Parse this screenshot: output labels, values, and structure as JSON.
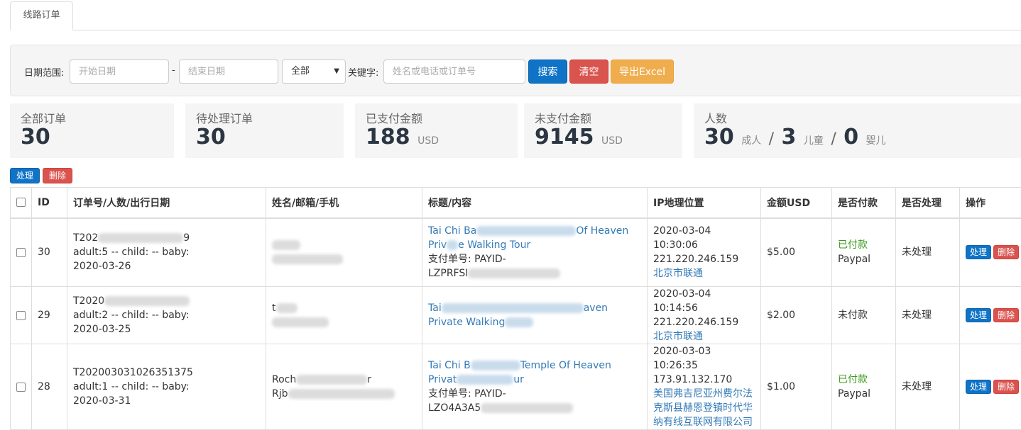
{
  "tabs": [
    {
      "label": "线路订单",
      "active": true
    }
  ],
  "filter": {
    "date_range_label": "日期范围:",
    "start_placeholder": "开始日期",
    "dash": "-",
    "end_placeholder": "结束日期",
    "status_select": "全部",
    "keyword_label": "关键字:",
    "keyword_placeholder": "姓名或电话或订单号",
    "search_button": "搜索",
    "clear_button": "清空",
    "export_button": "导出Excel"
  },
  "stats": {
    "all_orders": {
      "title": "全部订单",
      "value": "30"
    },
    "pending_orders": {
      "title": "待处理订单",
      "value": "30"
    },
    "paid_amount": {
      "title": "已支付金额",
      "value": "188",
      "unit": "USD"
    },
    "unpaid_amount": {
      "title": "未支付金额",
      "value": "9145",
      "unit": "USD"
    },
    "people": {
      "title": "人数",
      "adults": "30",
      "adults_label": "成人",
      "children": "3",
      "children_label": "儿童",
      "babies": "0",
      "babies_label": "婴儿",
      "sep": "/"
    }
  },
  "bulk": {
    "process_label": "处理",
    "delete_label": "删除"
  },
  "table": {
    "headers": {
      "id": "ID",
      "order": "订单号/人数/出行日期",
      "contact": "姓名/邮箱/手机",
      "title": "标题/内容",
      "ip": "IP地理位置",
      "amount": "金额USD",
      "paid": "是否付款",
      "processed": "是否处理",
      "ops": "操作"
    },
    "rows": [
      {
        "id": "30",
        "order_no_start": "T202",
        "order_no_end": "9",
        "people": "adult:5 -- child: -- baby:",
        "travel_date": "2020-03-26",
        "title_start": "Tai Chi Ba",
        "title_end": "Of Heaven",
        "title_line2_start": "Priv",
        "title_line2_end": "e Walking Tour",
        "payment_label": "支付单号: PAYID-",
        "payment_id": "LZPRFSI",
        "ip_time": "2020-03-04 10:30:06",
        "ip": "221.220.246.159",
        "location": "北京市联通",
        "amount": "$5.00",
        "paid_status": "已付款",
        "paid_method": "Paypal",
        "processed": "未处理",
        "process_btn": "处理",
        "delete_btn": "删除"
      },
      {
        "id": "29",
        "order_no_start": "T2020",
        "people": "adult:2 -- child: -- baby:",
        "travel_date": "2020-03-25",
        "contact_start": "t",
        "title_start": "Tai",
        "title_end": "aven",
        "title_line2_start": "Private Walking",
        "ip_time": "2020-03-04 10:14:56",
        "ip": "221.220.246.159",
        "location": "北京市联通",
        "amount": "$2.00",
        "paid_status": "未付款",
        "processed": "未处理",
        "process_btn": "处理",
        "delete_btn": "删除"
      },
      {
        "id": "28",
        "order_no": "T202003031026351375",
        "people": "adult:1 -- child: -- baby:",
        "travel_date": "2020-03-31",
        "contact_start": "Roch",
        "contact_end": "r",
        "contact_line2_start": "Rjb",
        "title_start": "Tai Chi B",
        "title_end": "Temple Of Heaven",
        "title_line2_start": "Privat",
        "title_line2_end": "ur",
        "payment_label": "支付单号: PAYID-",
        "payment_id": "LZO4A3A5",
        "ip_time": "2020-03-03 10:26:35",
        "ip": "173.91.132.170",
        "location": "美国弗吉尼亚州费尔法克斯县赫恩登镇时代华纳有线互联网有限公司",
        "amount": "$1.00",
        "paid_status": "已付款",
        "paid_method": "Paypal",
        "processed": "未处理",
        "process_btn": "处理",
        "delete_btn": "删除"
      }
    ]
  }
}
